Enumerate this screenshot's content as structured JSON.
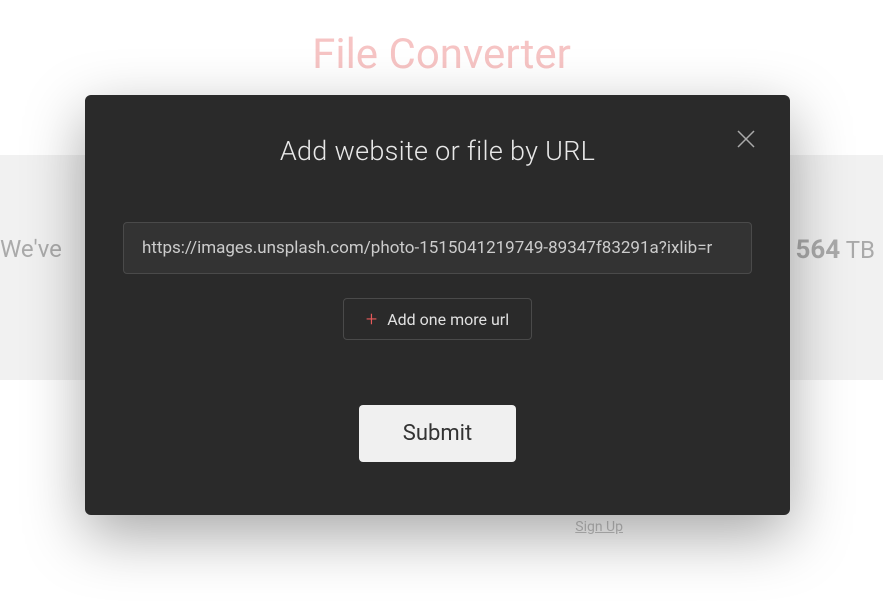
{
  "background": {
    "title": "File Converter",
    "stats_left": "We've",
    "stats_right_value": "564",
    "stats_right_unit": "TB",
    "signup": "Sign Up"
  },
  "modal": {
    "title": "Add website or file by URL",
    "url_value": "https://images.unsplash.com/photo-1515041219749-89347f83291a?ixlib=r",
    "add_more_label": "Add one more url",
    "submit_label": "Submit"
  }
}
